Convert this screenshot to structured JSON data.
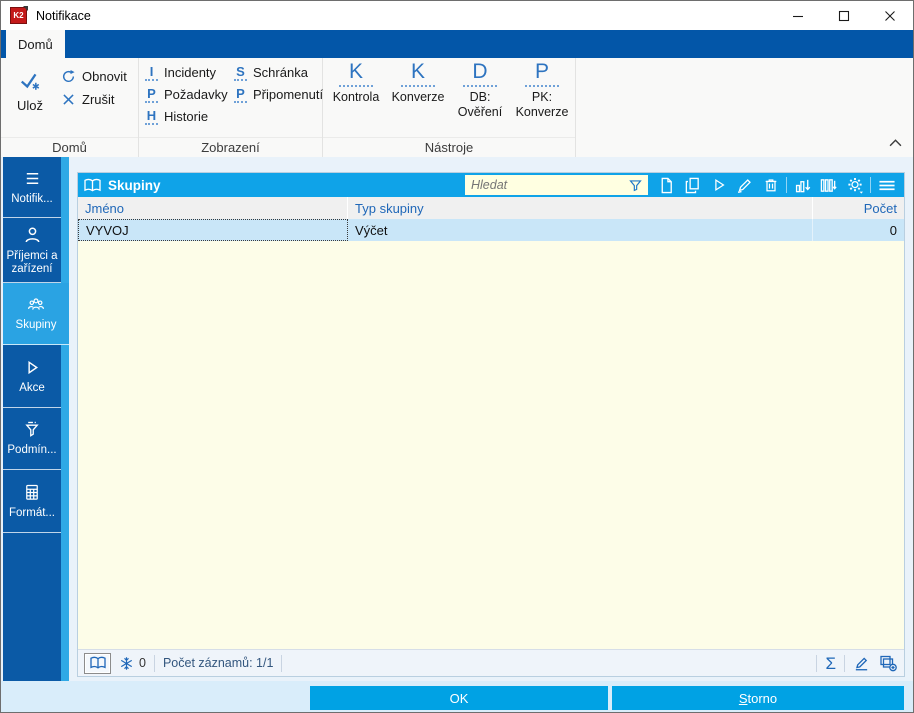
{
  "window": {
    "title": "Notifikace",
    "logo_text": "K2"
  },
  "ribbon": {
    "tab": "Domů",
    "home": {
      "label": "Domů",
      "save": "Ulož",
      "refresh": "Obnovit",
      "cancel": "Zrušit"
    },
    "view": {
      "label": "Zobrazení",
      "items": [
        {
          "letter": "I",
          "label": "Incidenty"
        },
        {
          "letter": "P",
          "label": "Požadavky"
        },
        {
          "letter": "H",
          "label": "Historie"
        },
        {
          "letter": "S",
          "label": "Schránka"
        },
        {
          "letter": "P",
          "label": "Připomenutí"
        }
      ]
    },
    "tools": {
      "label": "Nástroje",
      "items": [
        {
          "letter": "K",
          "line1": "Kontrola",
          "line2": ""
        },
        {
          "letter": "K",
          "line1": "Konverze",
          "line2": ""
        },
        {
          "letter": "D",
          "line1": "DB:",
          "line2": "Ověření"
        },
        {
          "letter": "P",
          "line1": "PK:",
          "line2": "Konverze"
        }
      ]
    }
  },
  "sidebar": {
    "items": [
      {
        "label": "Notifik..."
      },
      {
        "label": "Příjemci a zařízení"
      },
      {
        "label": "Skupiny"
      },
      {
        "label": "Akce"
      },
      {
        "label": "Podmín..."
      },
      {
        "label": "Formát..."
      }
    ]
  },
  "panel": {
    "title": "Skupiny",
    "search_placeholder": "Hledat",
    "columns": [
      "Jméno",
      "Typ skupiny",
      "Počet"
    ],
    "rows": [
      [
        "VYVOJ",
        "Výčet",
        "0"
      ]
    ],
    "status": {
      "mode_count": "0",
      "records": "Počet záznamů: 1/1"
    }
  },
  "footer": {
    "ok": "OK",
    "storno_initial": "S",
    "storno_rest": "torno"
  },
  "icons": {
    "sum": "Σ"
  },
  "colors": {
    "tabbar": "#0356a8",
    "sidebar": "#0b5aa6",
    "sidebar_selected": "#2aa3e3",
    "panel_header": "#0fa3e8",
    "footer_button": "#00a2e4",
    "row_bg": "#c9e6f8",
    "grid_bg": "#fdfde8",
    "search_bg": "#ffffe1",
    "ribbon_icon_blue": "#2e74c0"
  }
}
